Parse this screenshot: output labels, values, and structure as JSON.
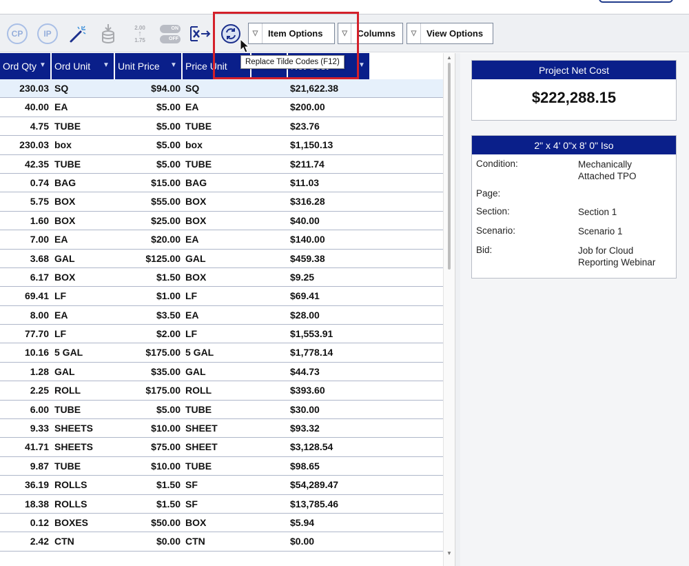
{
  "toolbar": {
    "icons": [
      {
        "name": "cp-icon",
        "text": "CP"
      },
      {
        "name": "ip-icon",
        "text": "IP"
      },
      {
        "name": "magic-wand-icon"
      },
      {
        "name": "database-download-icon"
      },
      {
        "name": "rounding-icon",
        "top": "2.00",
        "bottom": "1.75"
      },
      {
        "name": "toggle-on-off-icon",
        "on": "ON",
        "off": "OFF"
      },
      {
        "name": "export-x-icon"
      },
      {
        "name": "replace-tilde-icon"
      }
    ],
    "item_options_label": "Item Options",
    "columns_label": "Columns",
    "view_options_label": "View Options",
    "tooltip": "Replace Tilde Codes (F12)"
  },
  "grid": {
    "headers": [
      "Ord Qty",
      "Ord Unit",
      "Unit Price",
      "Price Unit",
      "",
      "Net Cost"
    ],
    "rows": [
      [
        "230.03",
        "SQ",
        "$94.00",
        "SQ",
        "$21,622.38"
      ],
      [
        "40.00",
        "EA",
        "$5.00",
        "EA",
        "$200.00"
      ],
      [
        "4.75",
        "TUBE",
        "$5.00",
        "TUBE",
        "$23.76"
      ],
      [
        "230.03",
        "box",
        "$5.00",
        "box",
        "$1,150.13"
      ],
      [
        "42.35",
        "TUBE",
        "$5.00",
        "TUBE",
        "$211.74"
      ],
      [
        "0.74",
        "BAG",
        "$15.00",
        "BAG",
        "$11.03"
      ],
      [
        "5.75",
        "BOX",
        "$55.00",
        "BOX",
        "$316.28"
      ],
      [
        "1.60",
        "BOX",
        "$25.00",
        "BOX",
        "$40.00"
      ],
      [
        "7.00",
        "EA",
        "$20.00",
        "EA",
        "$140.00"
      ],
      [
        "3.68",
        "GAL",
        "$125.00",
        "GAL",
        "$459.38"
      ],
      [
        "6.17",
        "BOX",
        "$1.50",
        "BOX",
        "$9.25"
      ],
      [
        "69.41",
        "LF",
        "$1.00",
        "LF",
        "$69.41"
      ],
      [
        "8.00",
        "EA",
        "$3.50",
        "EA",
        "$28.00"
      ],
      [
        "77.70",
        "LF",
        "$2.00",
        "LF",
        "$1,553.91"
      ],
      [
        "10.16",
        "5 GAL",
        "$175.00",
        "5 GAL",
        "$1,778.14"
      ],
      [
        "1.28",
        "GAL",
        "$35.00",
        "GAL",
        "$44.73"
      ],
      [
        "2.25",
        "ROLL",
        "$175.00",
        "ROLL",
        "$393.60"
      ],
      [
        "6.00",
        "TUBE",
        "$5.00",
        "TUBE",
        "$30.00"
      ],
      [
        "9.33",
        "SHEETS",
        "$10.00",
        "SHEET",
        "$93.32"
      ],
      [
        "41.71",
        "SHEETS",
        "$75.00",
        "SHEET",
        "$3,128.54"
      ],
      [
        "9.87",
        "TUBE",
        "$10.00",
        "TUBE",
        "$98.65"
      ],
      [
        "36.19",
        "ROLLS",
        "$1.50",
        "SF",
        "$54,289.47"
      ],
      [
        "18.38",
        "ROLLS",
        "$1.50",
        "SF",
        "$13,785.46"
      ],
      [
        "0.12",
        "BOXES",
        "$50.00",
        "BOX",
        "$5.94"
      ],
      [
        "2.42",
        "CTN",
        "$0.00",
        "CTN",
        "$0.00"
      ]
    ]
  },
  "net_cost_card": {
    "title": "Project Net Cost",
    "amount": "$222,288.15"
  },
  "item_card": {
    "title": "2\" x 4' 0\"x 8' 0\" Iso",
    "fields": [
      {
        "label": "Condition:",
        "value": "Mechanically Attached TPO"
      },
      {
        "label": "Page:",
        "value": ""
      },
      {
        "label": "Section:",
        "value": "Section 1"
      },
      {
        "label": "Scenario:",
        "value": "Scenario 1"
      },
      {
        "label": "Bid:",
        "value": "Job for Cloud Reporting Webinar"
      }
    ]
  },
  "colors": {
    "header_bg": "#0a1f8a",
    "highlight": "#d4202a",
    "selected_row": "#e6f0fb"
  }
}
